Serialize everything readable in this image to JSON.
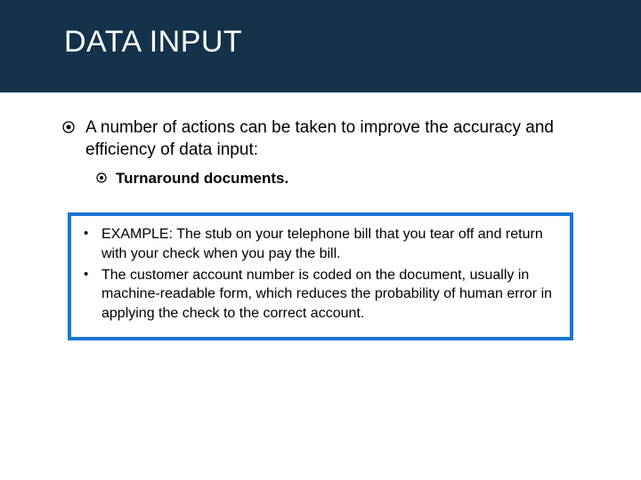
{
  "header": {
    "title": "DATA INPUT"
  },
  "main": {
    "point": "A number of actions can be taken to improve the accuracy and efficiency of data input:",
    "sub": "Turnaround documents."
  },
  "example": {
    "items": [
      "EXAMPLE: The stub on your telephone bill that you tear off and return with your check when you pay the bill.",
      "The customer account number is coded on the document, usually in machine-readable form, which reduces the probability of human error in applying the check to the correct account."
    ]
  }
}
